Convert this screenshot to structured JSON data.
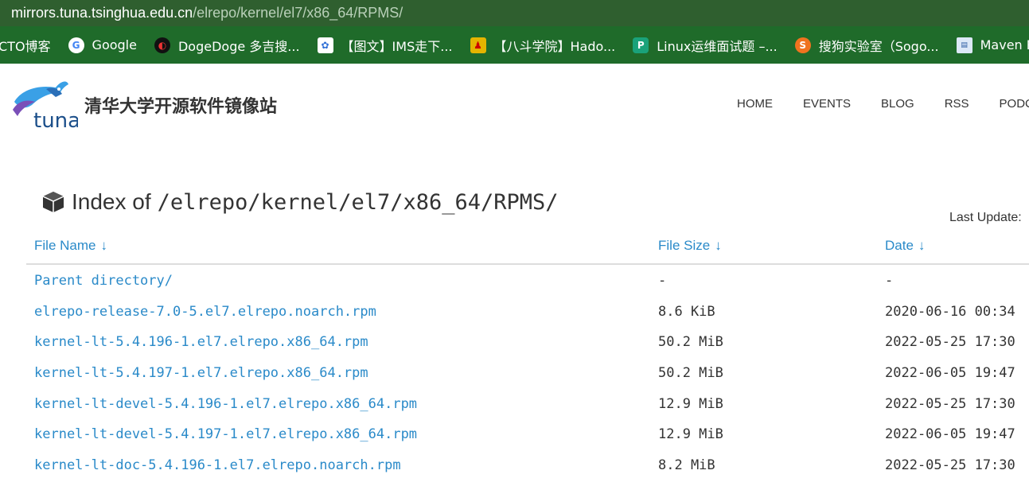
{
  "address_bar": {
    "host": "mirrors.tuna.tsinghua.edu.cn",
    "path": "/elrepo/kernel/el7/x86_64/RPMS/"
  },
  "bookmarks": [
    {
      "label": "CTO博客",
      "icon": "cto-icon",
      "color": "#ffffff"
    },
    {
      "label": "Google",
      "icon": "google-icon",
      "color": "#4285f4"
    },
    {
      "label": "DogeDoge 多吉搜...",
      "icon": "dogedoge-icon",
      "color": "#d22"
    },
    {
      "label": "【图文】IMS走下...",
      "icon": "baidu-icon",
      "color": "#2f6fd6"
    },
    {
      "label": "【八斗学院】Hado...",
      "icon": "badou-icon",
      "color": "#e4b400"
    },
    {
      "label": "Linux运维面试题 –...",
      "icon": "p-icon",
      "color": "#1aa27a"
    },
    {
      "label": "搜狗实验室（Sogo...",
      "icon": "sogou-icon",
      "color": "#f0731f"
    },
    {
      "label": "Maven Repository...",
      "icon": "maven-icon",
      "color": "#8fb7e6"
    }
  ],
  "site": {
    "logo_text": "tuna",
    "title": "清华大学开源软件镜像站",
    "nav": [
      "HOME",
      "EVENTS",
      "BLOG",
      "RSS",
      "PODCA"
    ]
  },
  "index": {
    "prefix": "Index of",
    "path": "/elrepo/kernel/el7/x86_64/RPMS/",
    "last_update_label": "Last Update:"
  },
  "table": {
    "headers": {
      "name": "File Name",
      "size": "File Size",
      "date": "Date",
      "arrow": "↓"
    },
    "rows": [
      {
        "name": "Parent directory/",
        "size": "-",
        "date": "-"
      },
      {
        "name": "elrepo-release-7.0-5.el7.elrepo.noarch.rpm",
        "size": "8.6 KiB",
        "date": "2020-06-16 00:34"
      },
      {
        "name": "kernel-lt-5.4.196-1.el7.elrepo.x86_64.rpm",
        "size": "50.2 MiB",
        "date": "2022-05-25 17:30"
      },
      {
        "name": "kernel-lt-5.4.197-1.el7.elrepo.x86_64.rpm",
        "size": "50.2 MiB",
        "date": "2022-06-05 19:47"
      },
      {
        "name": "kernel-lt-devel-5.4.196-1.el7.elrepo.x86_64.rpm",
        "size": "12.9 MiB",
        "date": "2022-05-25 17:30"
      },
      {
        "name": "kernel-lt-devel-5.4.197-1.el7.elrepo.x86_64.rpm",
        "size": "12.9 MiB",
        "date": "2022-06-05 19:47"
      },
      {
        "name": "kernel-lt-doc-5.4.196-1.el7.elrepo.noarch.rpm",
        "size": "8.2 MiB",
        "date": "2022-05-25 17:30"
      }
    ]
  },
  "colors": {
    "link": "#2a8ac9",
    "bookmark_bar": "#1f6b2a",
    "address_bar": "#2f5f2f"
  }
}
